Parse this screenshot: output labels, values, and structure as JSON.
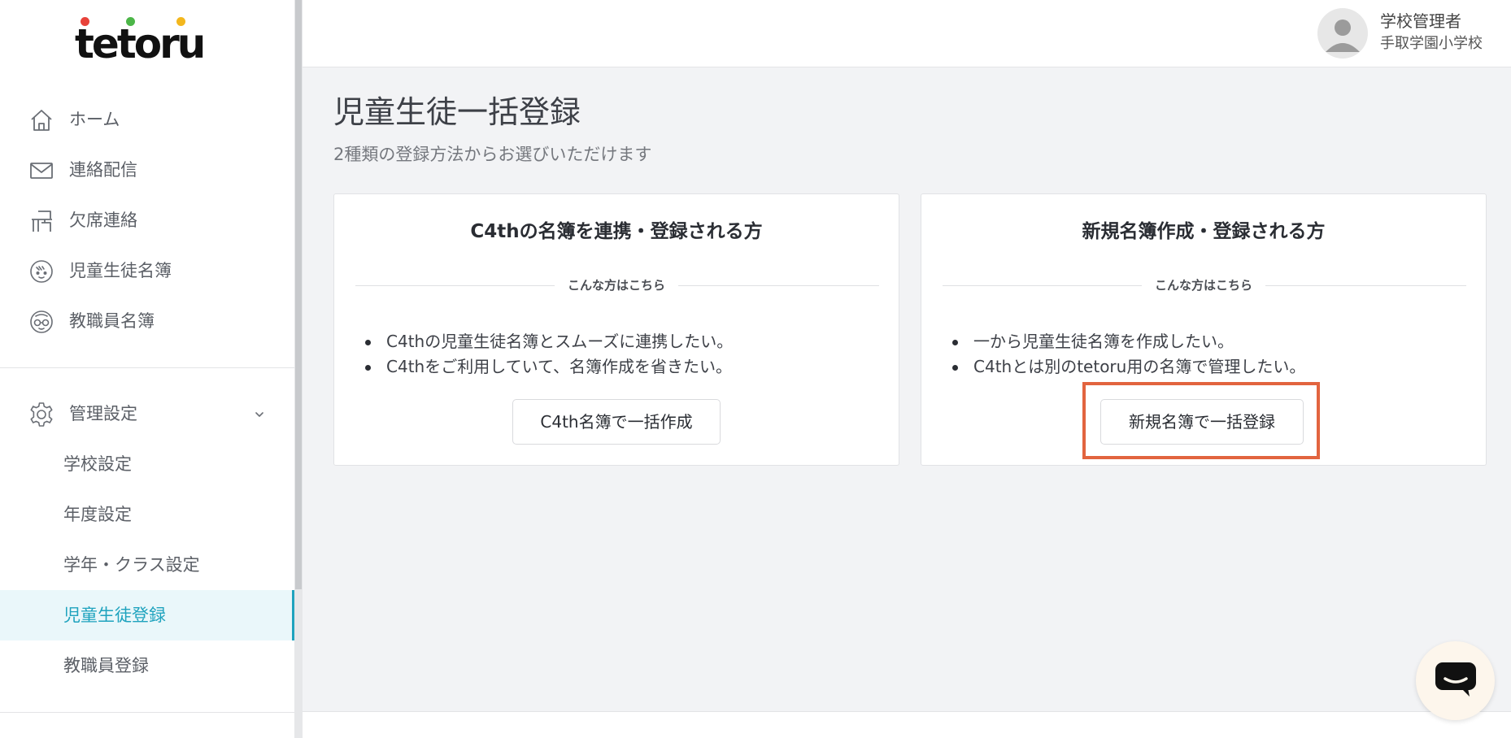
{
  "app": {
    "logo_text": "tetoru",
    "brand_colors": {
      "dot_red": "#e8423a",
      "dot_green": "#4cb648",
      "dot_yellow": "#f3b71d",
      "accent": "#1fa3be",
      "highlight": "#e2643f"
    }
  },
  "sidebar": {
    "items": [
      {
        "label": "ホーム",
        "icon": "home-icon"
      },
      {
        "label": "連絡配信",
        "icon": "mail-icon"
      },
      {
        "label": "欠席連絡",
        "icon": "desk-icon"
      },
      {
        "label": "児童生徒名簿",
        "icon": "student-face-icon"
      },
      {
        "label": "教職員名簿",
        "icon": "teacher-face-icon"
      }
    ],
    "settings": {
      "label": "管理設定",
      "icon": "gear-icon",
      "expanded": true,
      "sub_items": [
        {
          "label": "学校設定",
          "active": false
        },
        {
          "label": "年度設定",
          "active": false
        },
        {
          "label": "学年・クラス設定",
          "active": false
        },
        {
          "label": "児童生徒登録",
          "active": true
        },
        {
          "label": "教職員登録",
          "active": false
        }
      ]
    }
  },
  "header": {
    "user_role": "学校管理者",
    "school_name": "手取学園小学校",
    "avatar_icon": "user-avatar-icon"
  },
  "main": {
    "title": "児童生徒一括登録",
    "subtitle": "2種類の登録方法からお選びいただけます",
    "cards": [
      {
        "title": "C4thの名簿を連携・登録される方",
        "separator_label": "こんな方はこちら",
        "bullets": [
          "C4thの児童生徒名簿とスムーズに連携したい。",
          "C4thをご利用していて、名簿作成を省きたい。"
        ],
        "button_label": "C4th名簿で一括作成"
      },
      {
        "title": "新規名簿作成・登録される方",
        "separator_label": "こんな方はこちら",
        "bullets": [
          "一から児童生徒名簿を作成したい。",
          "C4thとは別のtetoru用の名簿で管理したい。"
        ],
        "button_label": "新規名簿で一括登録"
      }
    ]
  },
  "chat": {
    "icon": "chat-bubble-icon"
  }
}
